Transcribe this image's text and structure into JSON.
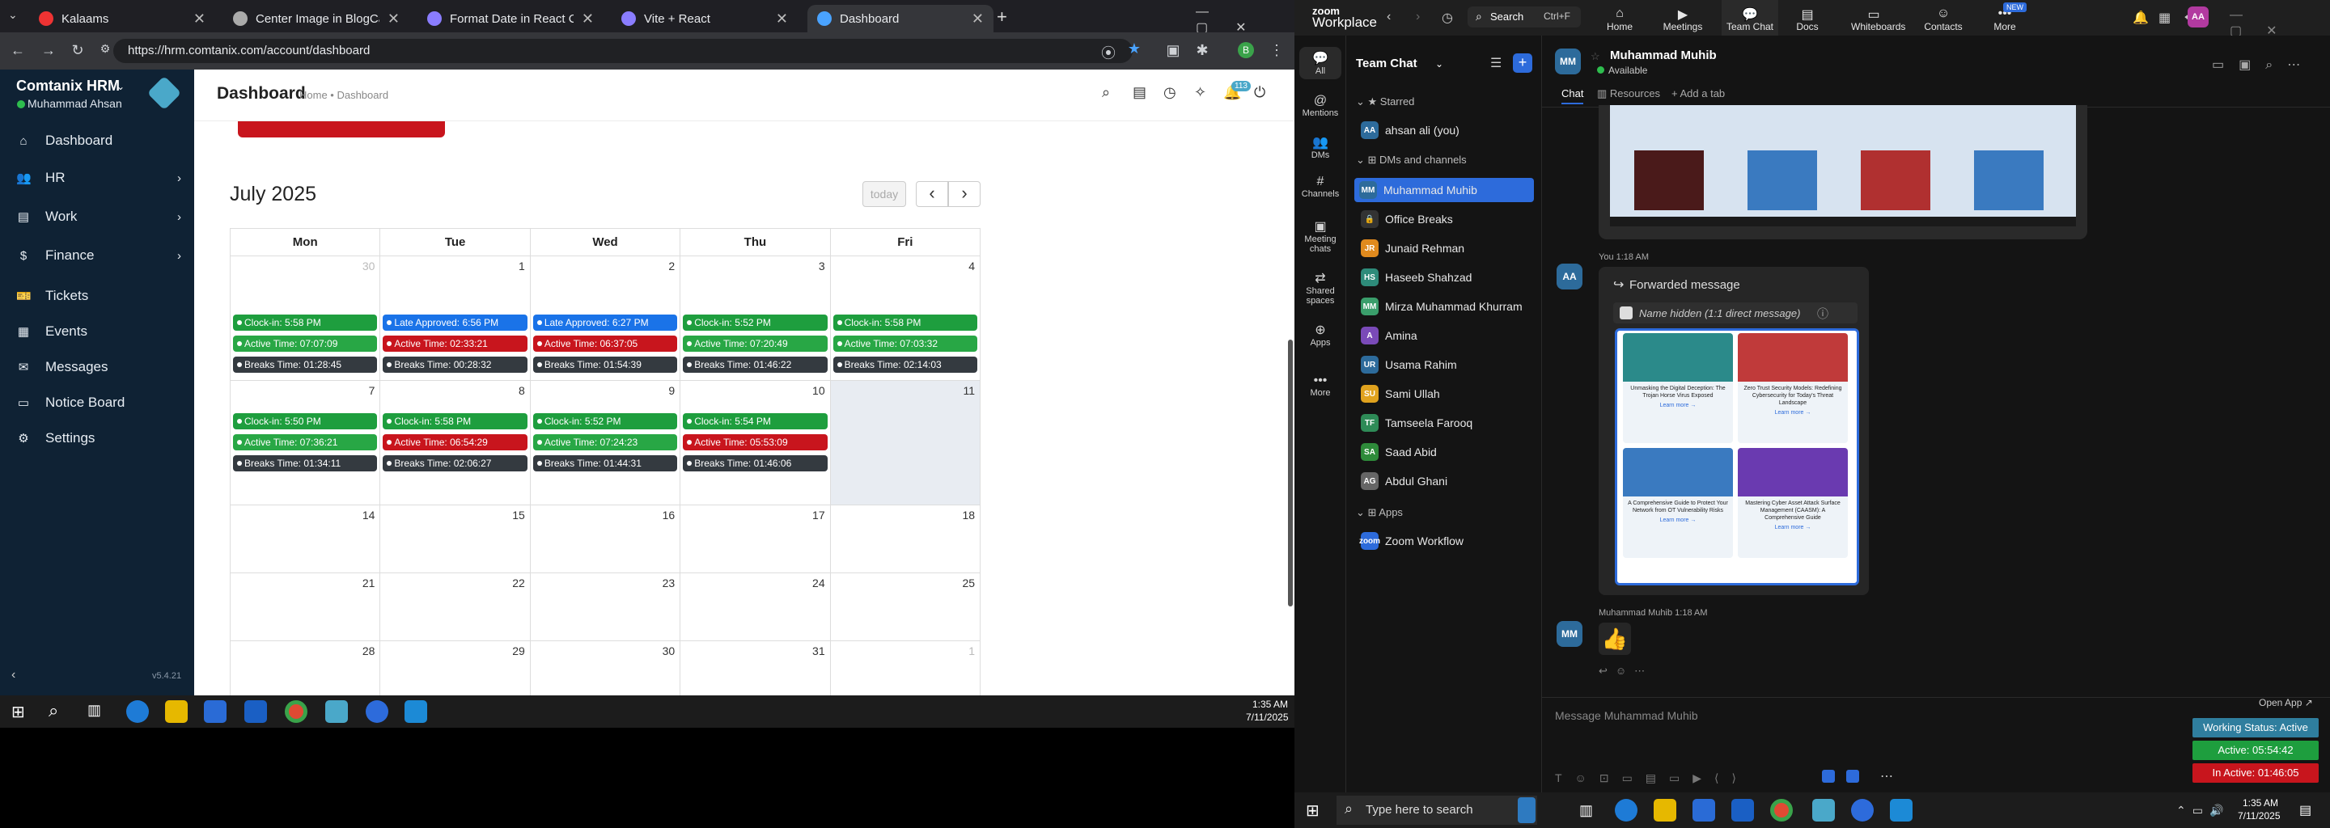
{
  "browser": {
    "tabs": [
      {
        "title": "Kalaams",
        "color": "#e33"
      },
      {
        "title": "Center Image in BlogCard",
        "color": "#aaa"
      },
      {
        "title": "Format Date in React Compone",
        "color": "#8a7dff"
      },
      {
        "title": "Vite + React",
        "color": "#8a7dff"
      },
      {
        "title": "Dashboard",
        "color": "#4aa3ff"
      }
    ],
    "new_tab": "+",
    "url": "https://hrm.comtanix.com/account/dashboard"
  },
  "hrm": {
    "brand": "Comtanix HRM",
    "user": "Muhammad Ahsan",
    "version": "v5.4.21",
    "menu": [
      {
        "label": "Dashboard",
        "icon": "⌂",
        "chev": ""
      },
      {
        "label": "HR",
        "icon": "👥",
        "chev": "›"
      },
      {
        "label": "Work",
        "icon": "▤",
        "chev": "›"
      },
      {
        "label": "Finance",
        "icon": "$",
        "chev": "›"
      },
      {
        "label": "Tickets",
        "icon": "🎫",
        "chev": ""
      },
      {
        "label": "Events",
        "icon": "▦",
        "chev": ""
      },
      {
        "label": "Messages",
        "icon": "✉",
        "chev": ""
      },
      {
        "label": "Notice Board",
        "icon": "▭",
        "chev": ""
      },
      {
        "label": "Settings",
        "icon": "⚙",
        "chev": ""
      }
    ],
    "page_title": "Dashboard",
    "breadcrumb": "Home • Dashboard",
    "notif_count": "113",
    "calendar": {
      "month": "July 2025",
      "today_btn": "today",
      "prev": "‹",
      "next": "›",
      "days": [
        "Mon",
        "Tue",
        "Wed",
        "Thu",
        "Fri"
      ],
      "rows": [
        [
          {
            "d": "30",
            "other": true,
            "ev": [
              [
                "green",
                "Clock-in: 5:58 PM"
              ],
              [
                "teal",
                "Active Time: 07:07:09"
              ],
              [
                "dark",
                "Breaks Time: 01:28:45"
              ]
            ]
          },
          {
            "d": "1",
            "ev": [
              [
                "blue",
                "Late Approved: 6:56 PM"
              ],
              [
                "red",
                "Active Time: 02:33:21"
              ],
              [
                "dark",
                "Breaks Time: 00:28:32"
              ]
            ]
          },
          {
            "d": "2",
            "ev": [
              [
                "blue",
                "Late Approved: 6:27 PM"
              ],
              [
                "red",
                "Active Time: 06:37:05"
              ],
              [
                "dark",
                "Breaks Time: 01:54:39"
              ]
            ]
          },
          {
            "d": "3",
            "ev": [
              [
                "green",
                "Clock-in: 5:52 PM"
              ],
              [
                "teal",
                "Active Time: 07:20:49"
              ],
              [
                "dark",
                "Breaks Time: 01:46:22"
              ]
            ]
          },
          {
            "d": "4",
            "ev": [
              [
                "green",
                "Clock-in: 5:58 PM"
              ],
              [
                "teal",
                "Active Time: 07:03:32"
              ],
              [
                "dark",
                "Breaks Time: 02:14:03"
              ]
            ]
          }
        ],
        [
          {
            "d": "7",
            "ev": [
              [
                "green",
                "Clock-in: 5:50 PM"
              ],
              [
                "teal",
                "Active Time: 07:36:21"
              ],
              [
                "dark",
                "Breaks Time: 01:34:11"
              ]
            ]
          },
          {
            "d": "8",
            "ev": [
              [
                "green",
                "Clock-in: 5:58 PM"
              ],
              [
                "red",
                "Active Time: 06:54:29"
              ],
              [
                "dark",
                "Breaks Time: 02:06:27"
              ]
            ]
          },
          {
            "d": "9",
            "ev": [
              [
                "green",
                "Clock-in: 5:52 PM"
              ],
              [
                "teal",
                "Active Time: 07:24:23"
              ],
              [
                "dark",
                "Breaks Time: 01:44:31"
              ]
            ]
          },
          {
            "d": "10",
            "ev": [
              [
                "green",
                "Clock-in: 5:54 PM"
              ],
              [
                "red",
                "Active Time: 05:53:09"
              ],
              [
                "dark",
                "Breaks Time: 01:46:06"
              ]
            ]
          },
          {
            "d": "11",
            "today": true,
            "ev": []
          }
        ],
        [
          {
            "d": "14",
            "ev": []
          },
          {
            "d": "15",
            "ev": []
          },
          {
            "d": "16",
            "ev": []
          },
          {
            "d": "17",
            "ev": []
          },
          {
            "d": "18",
            "ev": []
          }
        ],
        [
          {
            "d": "21",
            "ev": []
          },
          {
            "d": "22",
            "ev": []
          },
          {
            "d": "23",
            "ev": []
          },
          {
            "d": "24",
            "ev": []
          },
          {
            "d": "25",
            "ev": []
          }
        ],
        [
          {
            "d": "28",
            "ev": []
          },
          {
            "d": "29",
            "ev": []
          },
          {
            "d": "30",
            "ev": []
          },
          {
            "d": "31",
            "ev": []
          },
          {
            "d": "1",
            "other": true,
            "ev": []
          }
        ]
      ]
    }
  },
  "taskbar_left": {
    "time": "1:35 AM",
    "date": "7/11/2025"
  },
  "zoom": {
    "logo_top": "zoom",
    "logo_bottom": "Workplace",
    "search": "Search",
    "search_shortcut": "Ctrl+F",
    "nav": [
      {
        "label": "Home",
        "icon": "⌂"
      },
      {
        "label": "Meetings",
        "icon": "▶"
      },
      {
        "label": "Team Chat",
        "icon": "💬"
      },
      {
        "label": "Docs",
        "icon": "▤"
      },
      {
        "label": "Whiteboards",
        "icon": "▭"
      },
      {
        "label": "Contacts",
        "icon": "☺"
      },
      {
        "label": "More",
        "icon": "•••"
      }
    ],
    "more_badge": "NEW",
    "avatar": "AA",
    "rail": [
      {
        "label": "All",
        "icon": "💬"
      },
      {
        "label": "Mentions",
        "icon": "@"
      },
      {
        "label": "DMs",
        "icon": "👥"
      },
      {
        "label": "Channels",
        "icon": "#"
      },
      {
        "label": "Meeting chats",
        "icon": "▣"
      },
      {
        "label": "Shared spaces",
        "icon": "⇄"
      },
      {
        "label": "Apps",
        "icon": "⊕"
      },
      {
        "label": "More",
        "icon": "•••"
      }
    ],
    "panel_title": "Team Chat",
    "starred": "Starred",
    "starred_items": [
      {
        "name": "ahsan ali (you)",
        "initials": "AA",
        "color": "#2d6b9b"
      }
    ],
    "dms_title": "DMs and channels",
    "dms": [
      {
        "name": "Muhammad Muhib",
        "initials": "MM",
        "color": "#2d6b9b",
        "selected": true
      },
      {
        "name": "Office Breaks",
        "initials": "🔒",
        "color": "#333"
      },
      {
        "name": "Junaid Rehman",
        "initials": "JR",
        "color": "#e08a1e"
      },
      {
        "name": "Haseeb Shahzad",
        "initials": "HS",
        "color": "#2e8b7a"
      },
      {
        "name": "Mirza Muhammad Khurram",
        "initials": "MM",
        "color": "#3a9e6b"
      },
      {
        "name": "Amina",
        "initials": "A",
        "color": "#7a4ab8"
      },
      {
        "name": "Usama Rahim",
        "initials": "UR",
        "color": "#2d6b9b"
      },
      {
        "name": "Sami Ullah",
        "initials": "SU",
        "color": "#e0a21e"
      },
      {
        "name": "Tamseela Farooq",
        "initials": "TF",
        "color": "#2e8b57"
      },
      {
        "name": "Saad Abid",
        "initials": "SA",
        "color": "#2e8b3a"
      },
      {
        "name": "Abdul Ghani",
        "initials": "AG",
        "color": "#666"
      }
    ],
    "apps_title": "Apps",
    "apps": [
      {
        "name": "Zoom Workflow",
        "initials": "zoom",
        "color": "#2d6bdb"
      }
    ],
    "chat_name": "Muhammad Muhib",
    "chat_status": "Available",
    "chat_initials": "MM",
    "chat_tabs": [
      "Chat",
      "Resources",
      "Add a tab"
    ],
    "msg1_meta": "You 1:18 AM",
    "msg1_initials": "AA",
    "fwd_label": "Forwarded message",
    "hidden_label": "Name hidden (1:1 direct message)",
    "cards": [
      {
        "title": "Unmasking the Digital Deception: The Trojan Horse Virus Exposed",
        "foot": "Learn more →"
      },
      {
        "title": "Zero Trust Security Models: Redefining Cybersecurity for Today's Threat Landscape",
        "foot": "Learn more →"
      },
      {
        "title": "A Comprehensive Guide to Protect Your Network from OT Vulnerability Risks",
        "foot": "Learn more →"
      },
      {
        "title": "Mastering Cyber Asset Attack Surface Management (CAASM): A Comprehensive Guide",
        "foot": "Learn more →"
      }
    ],
    "msg2_meta": "Muhammad Muhib 1:18 AM",
    "msg2_initials": "MM",
    "msg2_body": "👍",
    "compose_placeholder": "Message Muhammad Muhib",
    "open_app": "Open App ↗",
    "widget": {
      "status": "Working Status: Active",
      "active": "Active: 05:54:42",
      "inactive": "In Active: 01:46:05"
    }
  },
  "taskbar_right": {
    "search": "Type here to search",
    "time": "1:35 AM",
    "date": "7/11/2025"
  }
}
